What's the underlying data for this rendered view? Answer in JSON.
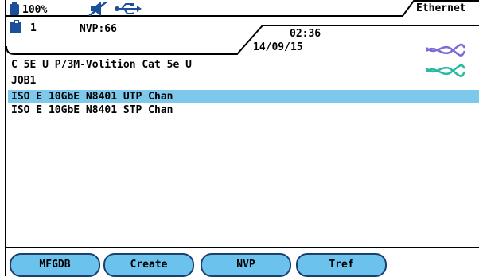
{
  "status": {
    "battery": "100%",
    "tab_title": "Ethernet",
    "jobs": "1",
    "nvp": "NVP:66",
    "time": "02:36",
    "date": "14/09/15"
  },
  "main": {
    "cable": "C 5E U P/3M-Volition Cat 5e U",
    "job": "JOB1",
    "items": [
      {
        "label": "ISO E 10GbE N8401 UTP Chan",
        "selected": true
      },
      {
        "label": "ISO E 10GbE N8401 STP Chan",
        "selected": false
      }
    ]
  },
  "softkeys": [
    "MFGDB",
    "Create",
    "NVP",
    "Tref"
  ],
  "colors": {
    "selection": "#7ec8ec",
    "softkey": "#6bc3ed",
    "icon_blue": "#1a4f9c",
    "twist_purple": "#7a6bd6",
    "twist_teal": "#2ab9a0"
  }
}
